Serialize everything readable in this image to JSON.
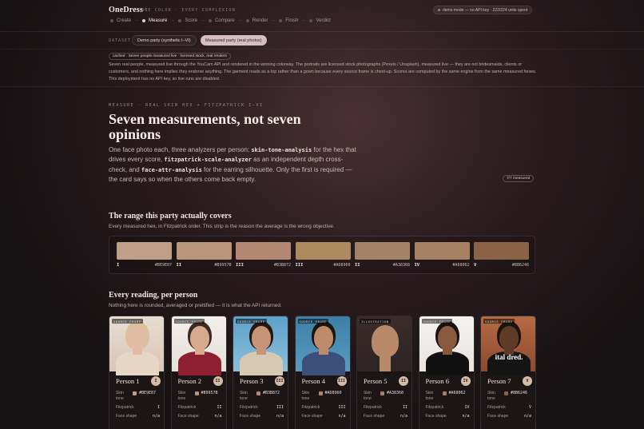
{
  "header": {
    "brand": "OneDress",
    "brand_sub": "ONE COLOR · EVERY COMPLEXION",
    "status": "demo mode — no API key · 222/224 units spent",
    "steps": [
      {
        "label": "Create",
        "active": false
      },
      {
        "label": "Measure",
        "active": true
      },
      {
        "label": "Score",
        "active": false
      },
      {
        "label": "Compare",
        "active": false
      },
      {
        "label": "Render",
        "active": false
      },
      {
        "label": "Finish",
        "active": false
      },
      {
        "label": "Verdict",
        "active": false
      }
    ]
  },
  "dataset": {
    "label": "DATASET",
    "options": [
      "Demo party (synthetic I–VI)",
      "Measured party (real photos)"
    ]
  },
  "notice": {
    "chip": "cached · Seven people measured live · licensed stock, real renders",
    "text": "Seven real people, measured live through the YouCam API and rendered in the winning colorway. The portraits are licensed stock photographs (Pexels / Unsplash), measured live — they are not bridesmaids, clients or customers, and nothing here implies they endorse anything. The garment reads as a top rather than a gown because every source frame is chest-up. Scores are computed by the same engine from the same measured hexes. This deployment has no API key, so live runs are disabled."
  },
  "hero": {
    "eyebrow": "MEASURE · REAL SKIN HEX + FITZPATRICK I–VI",
    "title": "Seven measurements, not seven opinions",
    "desc_1": "One face photo each, three analyzers per person: ",
    "code_1": "skin-tone-analysis",
    "desc_2": " for the hex that drives every score, ",
    "code_2": "fitzpatrick-scale-analyzer",
    "desc_3": " as an independent depth cross-check, and ",
    "code_3": "face-attr-analysis",
    "desc_4": " for the earring silhouette. Only the first is required — the card says so when the others come back empty.",
    "measured_chip": "7/7 measured"
  },
  "range": {
    "title": "The range this party actually covers",
    "subtitle": "Every measured hex, in Fitzpatrick order. This strip is the reason the average is the wrong objective.",
    "swatches": [
      {
        "roman": "I",
        "hex": "#BE9E87"
      },
      {
        "roman": "II",
        "hex": "#B9957B"
      },
      {
        "roman": "III",
        "hex": "#B3B872"
      },
      {
        "roman": "III",
        "hex": "#AD8960"
      },
      {
        "roman": "II",
        "hex": "#A38368"
      },
      {
        "roman": "IV",
        "hex": "#A68062"
      },
      {
        "roman": "V",
        "hex": "#8B6246"
      }
    ],
    "swatch_colors": [
      "#be9e87",
      "#b9957b",
      "#b38872",
      "#ad8960",
      "#a38368",
      "#a68062",
      "#8b6246"
    ]
  },
  "readings": {
    "title": "Every reading, per person",
    "subtitle": "Nothing here is rounded, averaged or prettified — it is what the API returned.",
    "row_labels": {
      "skin": "Skin tone",
      "fitz": "Fitzpatrick",
      "face": "Face shape"
    },
    "people": [
      {
        "tag": "SOURCE FRAME",
        "name": "Person 1",
        "badge": "I",
        "hex": "#BE9E87",
        "fitz": "I",
        "face": "n/a"
      },
      {
        "tag": "SOURCE FRAME",
        "name": "Person 2",
        "badge": "II",
        "hex": "#B9957B",
        "fitz": "II",
        "face": "n/a"
      },
      {
        "tag": "SOURCE FRAME",
        "name": "Person 3",
        "badge": "III",
        "hex": "#B3B872",
        "fitz": "III",
        "face": "n/a"
      },
      {
        "tag": "SOURCE FRAME",
        "name": "Person 4",
        "badge": "III",
        "hex": "#AD8960",
        "fitz": "III",
        "face": "n/a"
      },
      {
        "tag": "ILLUSTRATION",
        "name": "Person 5",
        "badge": "II",
        "hex": "#A38368",
        "fitz": "II",
        "face": "n/a"
      },
      {
        "tag": "SOURCE FRAME",
        "name": "Person 6",
        "badge": "IV",
        "hex": "#A68062",
        "fitz": "IV",
        "face": "n/a"
      },
      {
        "tag": "SOURCE FRAME",
        "name": "Person 7",
        "badge": "V",
        "hex": "#8B6246",
        "fitz": "V",
        "face": "n/a"
      }
    ],
    "hex_colors": [
      "#be9e87",
      "#b9957b",
      "#b38872",
      "#ad8960",
      "#a38368",
      "#a68062",
      "#8b6246"
    ],
    "tshirt_text": "ital dred."
  }
}
